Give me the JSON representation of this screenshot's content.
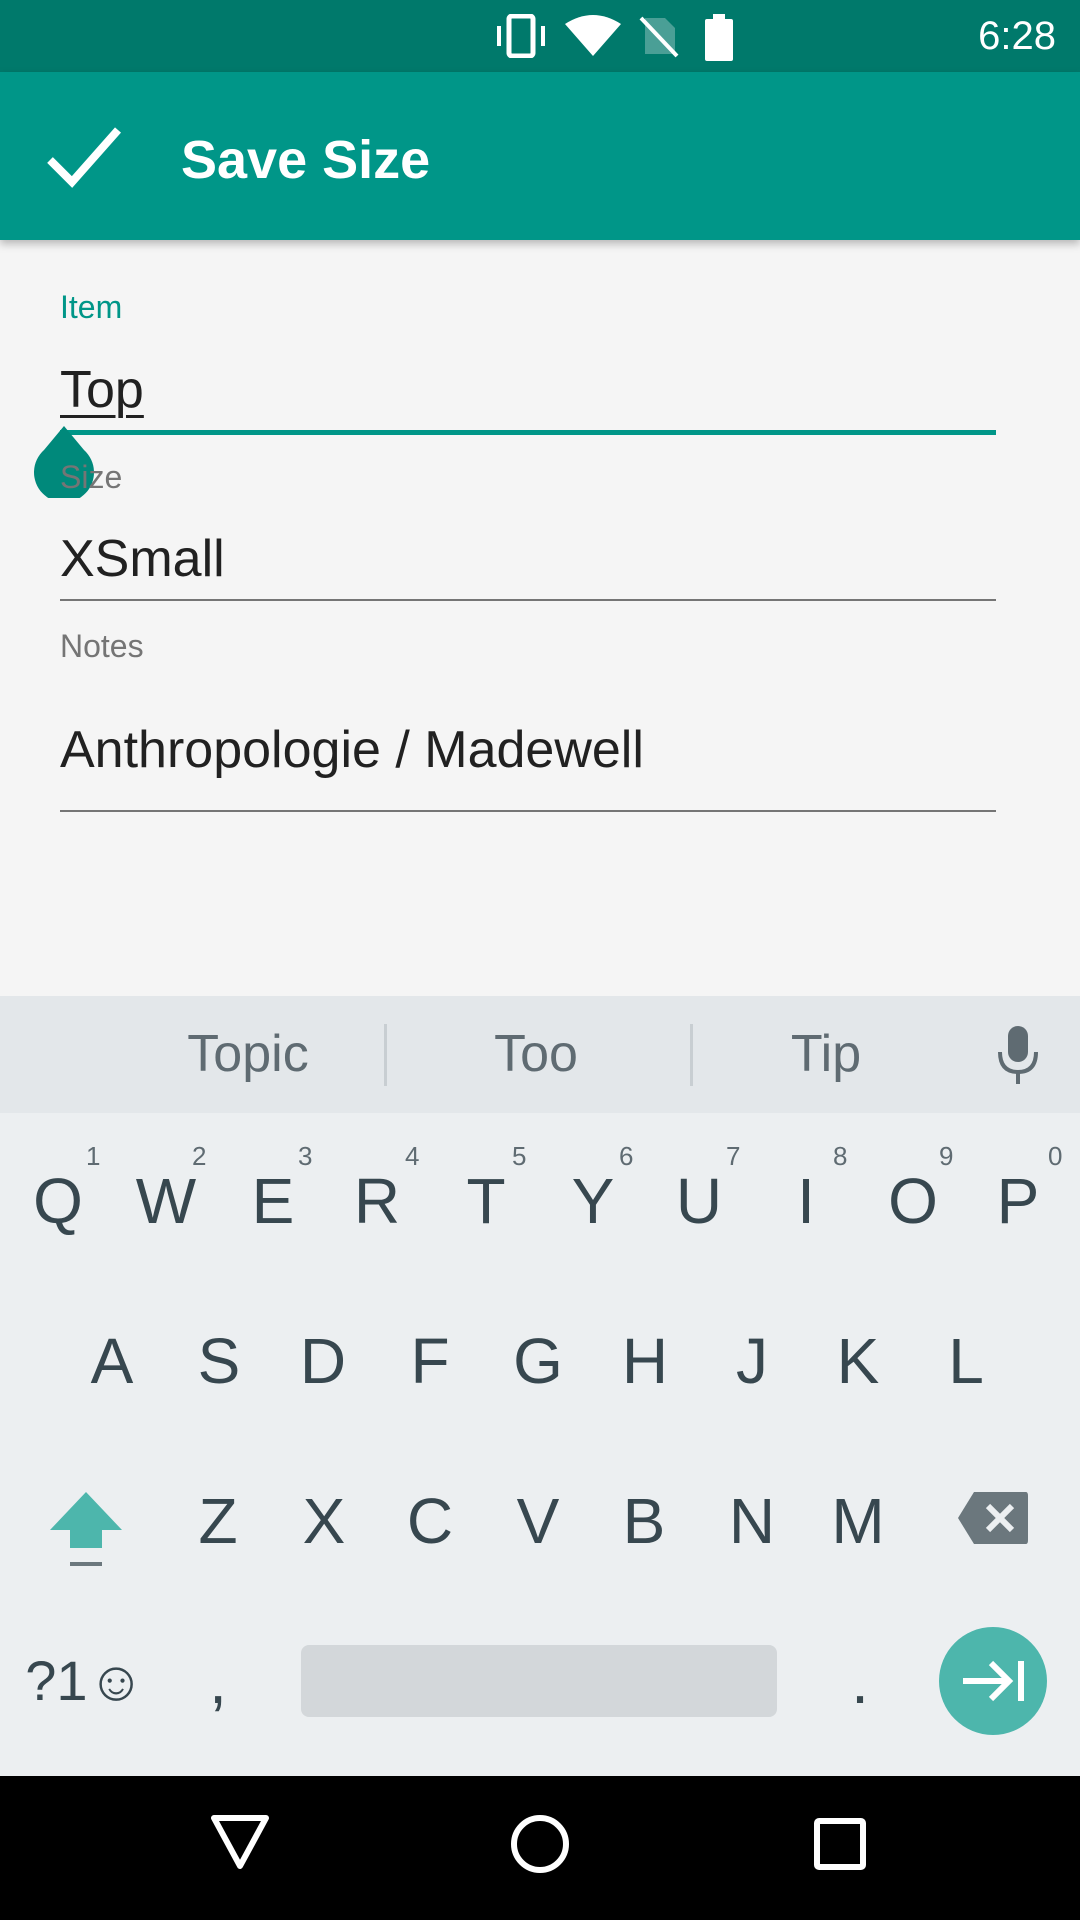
{
  "status_bar": {
    "time": "6:28",
    "icons": [
      "vibrate-icon",
      "wifi-icon",
      "no-sim-icon",
      "battery-icon"
    ]
  },
  "app_bar": {
    "action_icon": "check-icon",
    "title": "Save Size"
  },
  "form": {
    "item": {
      "label": "Item",
      "value": "Top"
    },
    "size": {
      "label": "Size",
      "value": "XSmall"
    },
    "notes": {
      "label": "Notes",
      "value": "Anthropologie / Madewell"
    }
  },
  "keyboard": {
    "suggestions": [
      "Topic",
      "Too",
      "Tip"
    ],
    "row1": [
      "Q",
      "W",
      "E",
      "R",
      "T",
      "Y",
      "U",
      "I",
      "O",
      "P"
    ],
    "row1_hints": [
      "1",
      "2",
      "3",
      "4",
      "5",
      "6",
      "7",
      "8",
      "9",
      "0"
    ],
    "row2": [
      "A",
      "S",
      "D",
      "F",
      "G",
      "H",
      "J",
      "K",
      "L"
    ],
    "row3": [
      "Z",
      "X",
      "C",
      "V",
      "B",
      "N",
      "M"
    ],
    "symbols_label": "?1☺",
    "comma": ",",
    "period": ".",
    "accent_color": "#4db6ac"
  },
  "colors": {
    "primary": "#009688",
    "primary_dark": "#00796b"
  }
}
